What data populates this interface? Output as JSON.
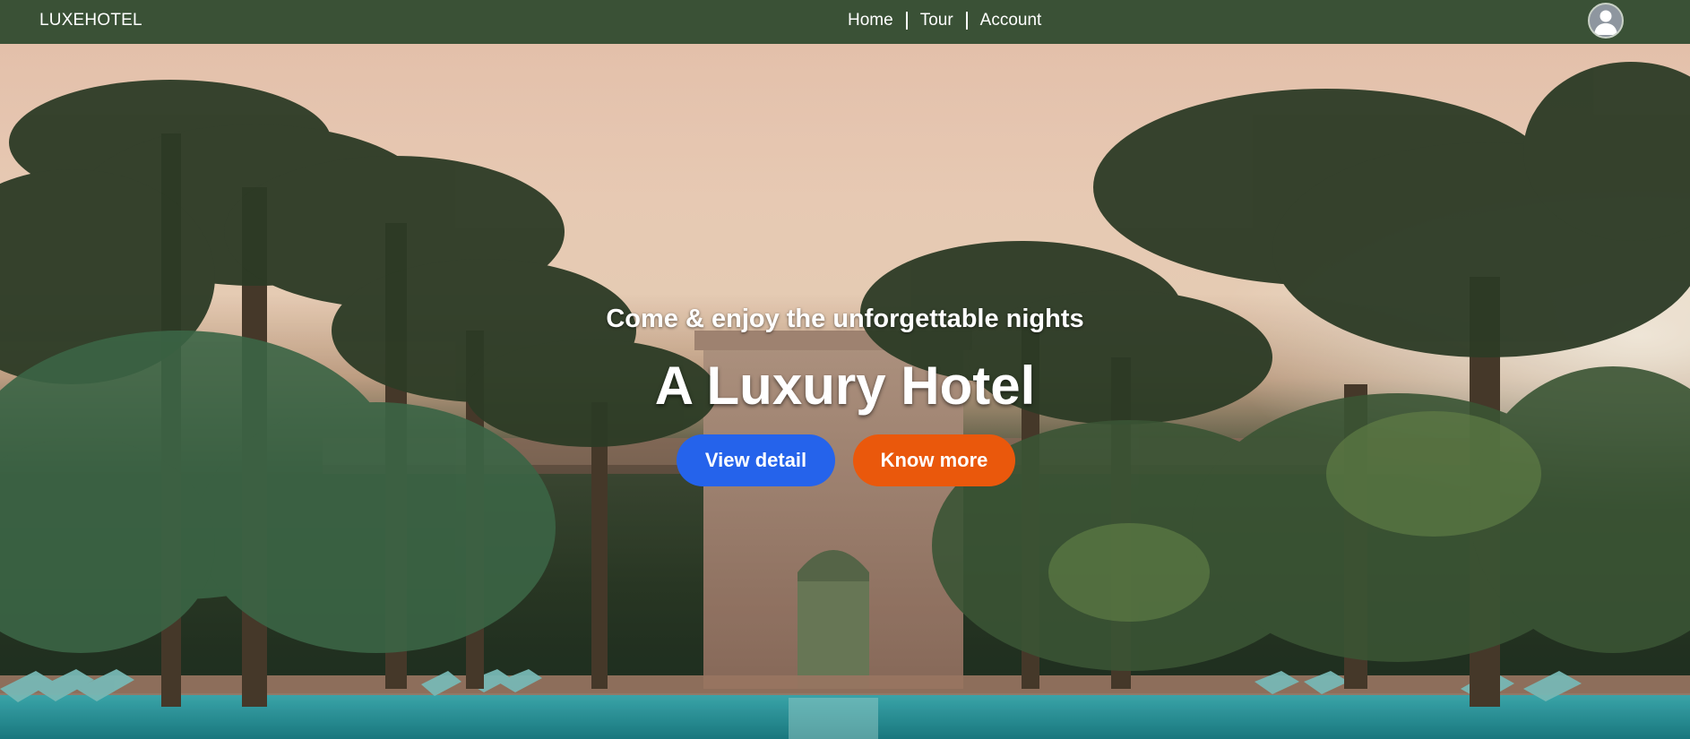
{
  "navbar": {
    "brand": "LUXEHOTEL",
    "links": [
      "Home",
      "Tour",
      "Account"
    ],
    "avatar_icon": "user-avatar-icon",
    "background_color": "#3a5136"
  },
  "hero": {
    "subtitle": "Come & enjoy the unforgettable nights",
    "title": "A Luxury Hotel",
    "buttons": {
      "view_detail": "View detail",
      "know_more": "Know more"
    },
    "button_colors": {
      "view_detail": "#2563eb",
      "know_more": "#ea580c"
    }
  }
}
